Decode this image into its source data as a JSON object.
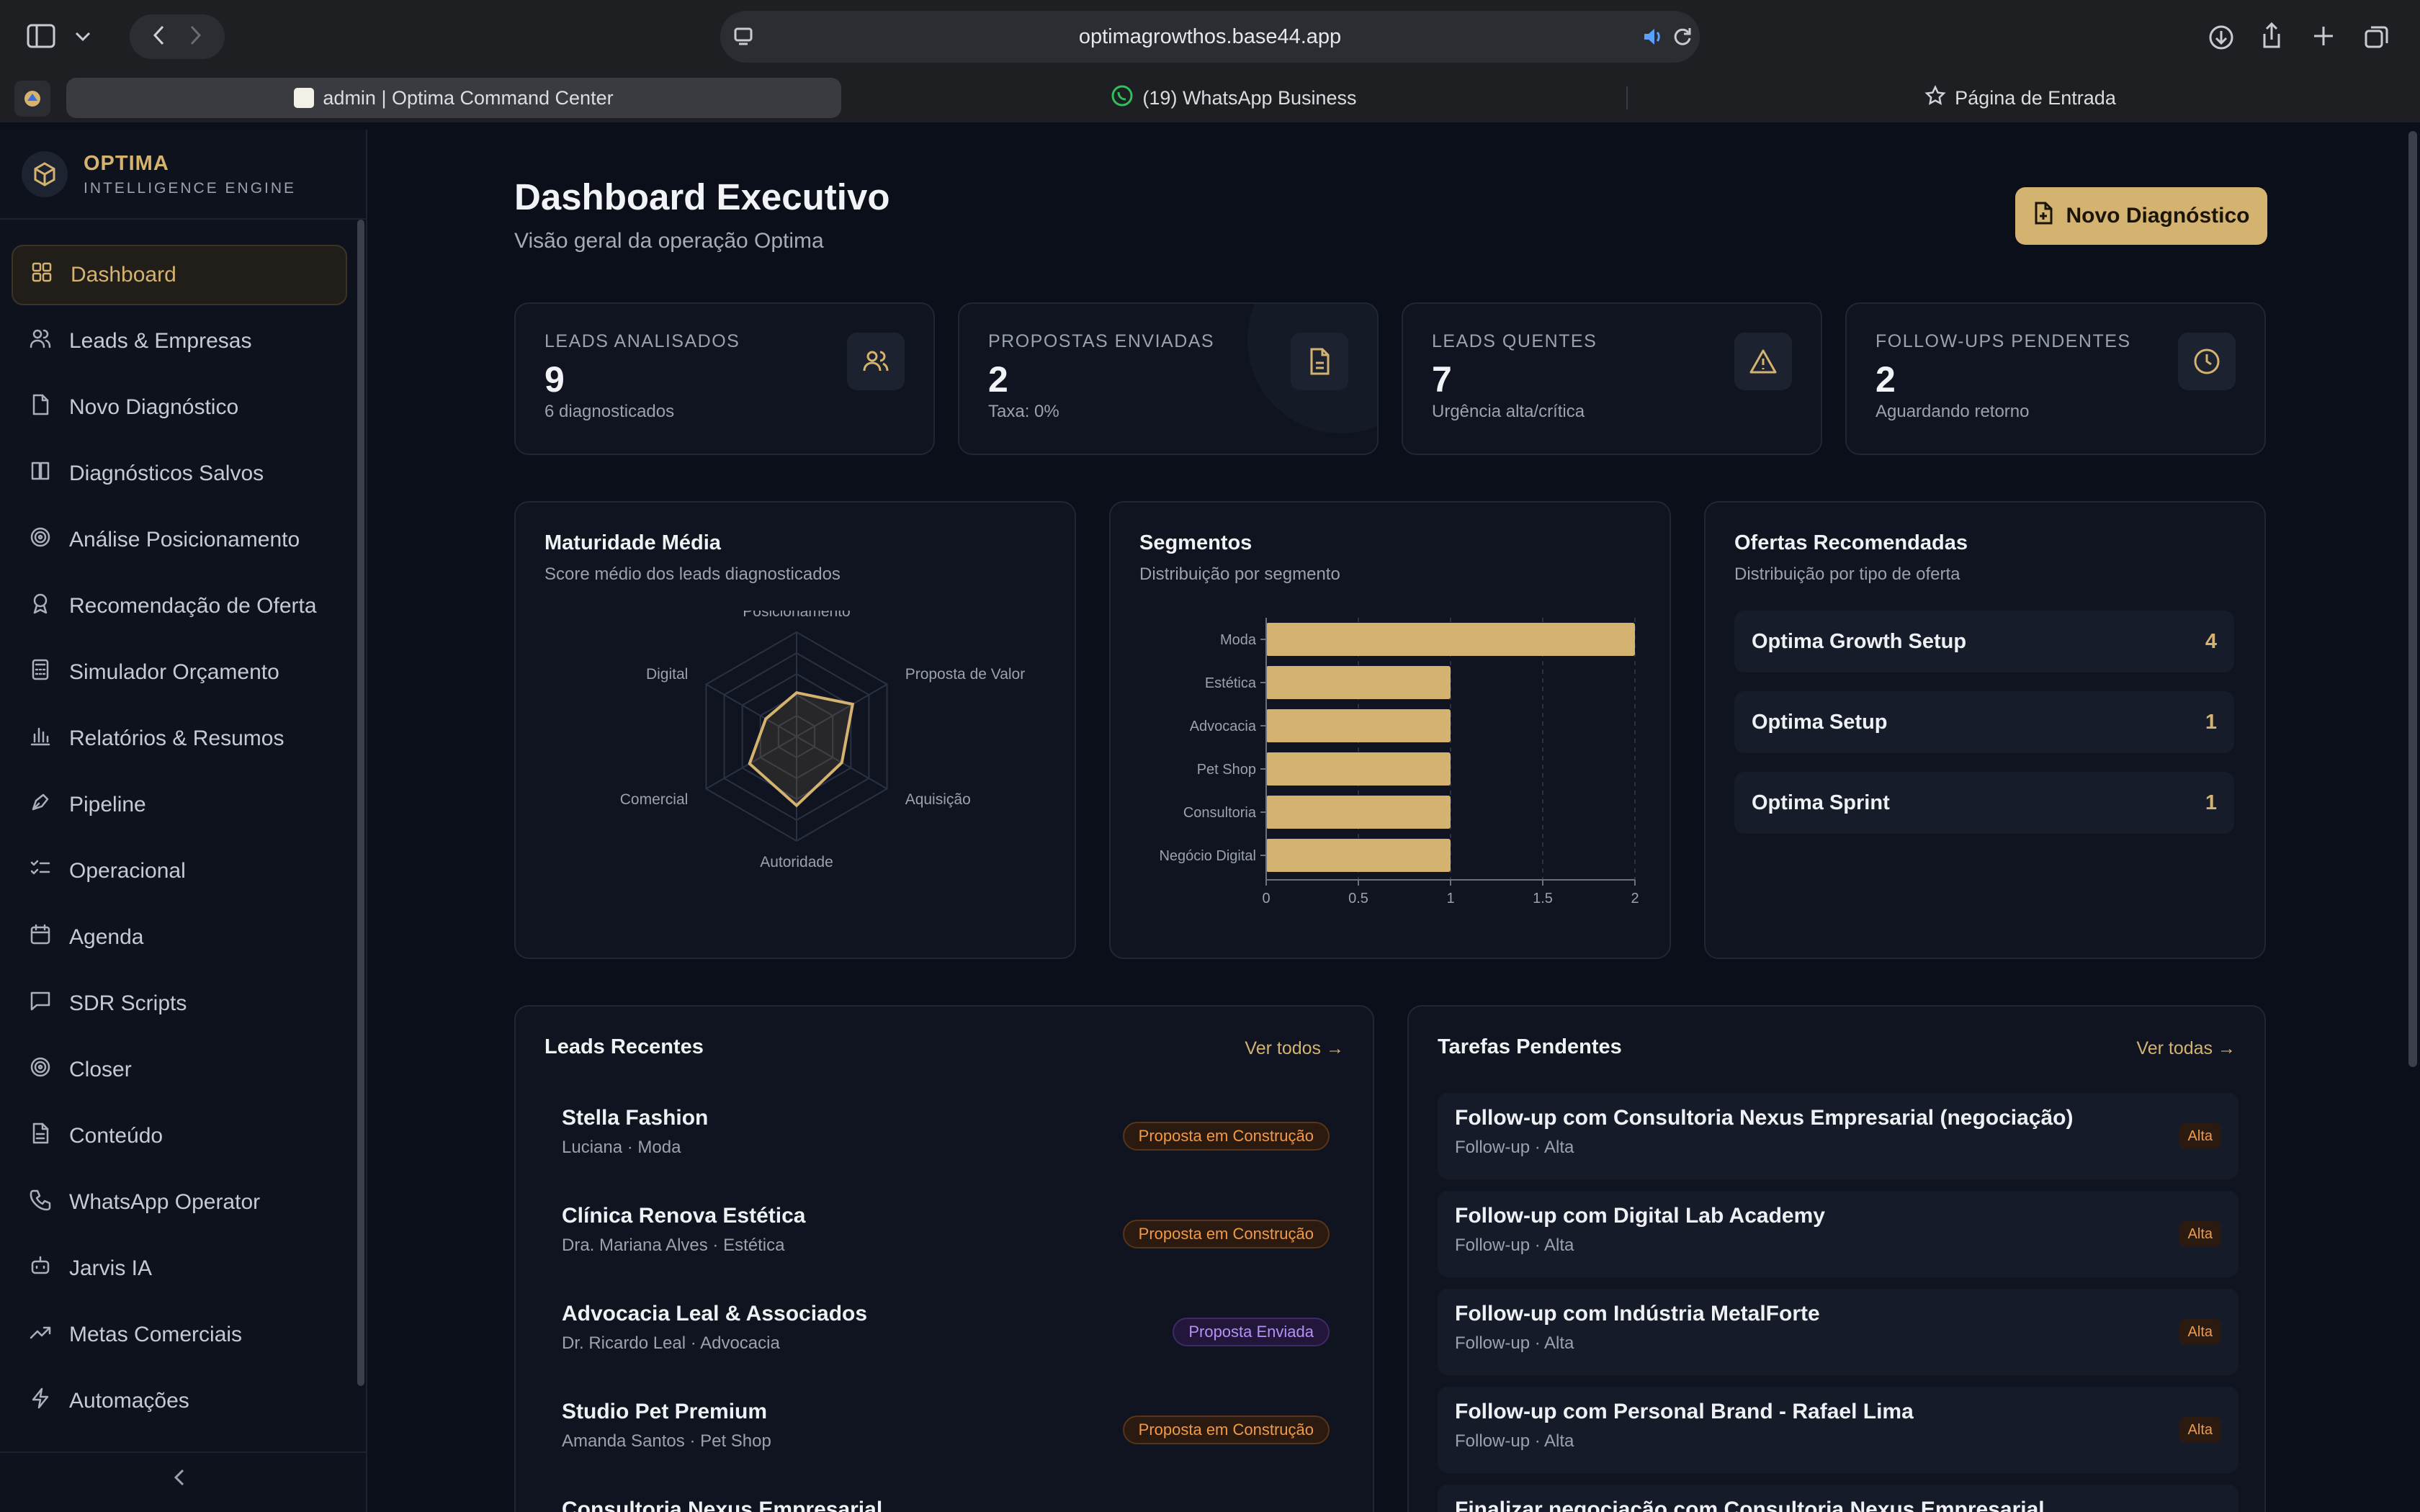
{
  "browser": {
    "url": "optimagrowthos.base44.app",
    "tabs": [
      {
        "label": "admin | Optima Command Center",
        "active": true
      },
      {
        "label": "(19) WhatsApp Business",
        "active": false
      },
      {
        "label": "Página de Entrada",
        "active": false
      }
    ]
  },
  "sidebar": {
    "brand_name": "OPTIMA",
    "brand_sub": "INTELLIGENCE ENGINE",
    "items": [
      {
        "label": "Dashboard",
        "icon": "grid-icon"
      },
      {
        "label": "Leads & Empresas",
        "icon": "users-icon"
      },
      {
        "label": "Novo Diagnóstico",
        "icon": "file-icon"
      },
      {
        "label": "Diagnósticos Salvos",
        "icon": "book-icon"
      },
      {
        "label": "Análise Posicionamento",
        "icon": "target-icon"
      },
      {
        "label": "Recomendação de Oferta",
        "icon": "award-icon"
      },
      {
        "label": "Simulador Orçamento",
        "icon": "calculator-icon"
      },
      {
        "label": "Relatórios & Resumos",
        "icon": "bar-chart-icon"
      },
      {
        "label": "Pipeline",
        "icon": "pen-tool-icon"
      },
      {
        "label": "Operacional",
        "icon": "list-checks-icon"
      },
      {
        "label": "Agenda",
        "icon": "calendar-icon"
      },
      {
        "label": "SDR Scripts",
        "icon": "message-square-icon"
      },
      {
        "label": "Closer",
        "icon": "target-icon"
      },
      {
        "label": "Conteúdo",
        "icon": "file-text-icon"
      },
      {
        "label": "WhatsApp Operator",
        "icon": "phone-icon"
      },
      {
        "label": "Jarvis IA",
        "icon": "bot-icon"
      },
      {
        "label": "Metas Comerciais",
        "icon": "trending-up-icon"
      },
      {
        "label": "Automações",
        "icon": "zap-icon"
      }
    ]
  },
  "header": {
    "title": "Dashboard Executivo",
    "subtitle": "Visão geral da operação Optima",
    "cta_label": "Novo Diagnóstico"
  },
  "stats": [
    {
      "label": "LEADS ANALISADOS",
      "value": "9",
      "sub": "6 diagnosticados",
      "icon": "users-icon"
    },
    {
      "label": "PROPOSTAS ENVIADAS",
      "value": "2",
      "sub": "Taxa: 0%",
      "icon": "file-icon"
    },
    {
      "label": "LEADS QUENTES",
      "value": "7",
      "sub": "Urgência alta/crítica",
      "icon": "alert-triangle-icon"
    },
    {
      "label": "FOLLOW-UPS PENDENTES",
      "value": "2",
      "sub": "Aguardando retorno",
      "icon": "clock-icon"
    }
  ],
  "maturity": {
    "title": "Maturidade Média",
    "subtitle": "Score médio dos leads diagnosticados"
  },
  "segments": {
    "title": "Segmentos",
    "subtitle": "Distribuição por segmento"
  },
  "offers": {
    "title": "Ofertas Recomendadas",
    "subtitle": "Distribuição por tipo de oferta",
    "items": [
      {
        "name": "Optima Growth Setup",
        "count": "4"
      },
      {
        "name": "Optima Setup",
        "count": "1"
      },
      {
        "name": "Optima Sprint",
        "count": "1"
      }
    ]
  },
  "recent_leads": {
    "title": "Leads Recentes",
    "see_all": "Ver todos →",
    "items": [
      {
        "name": "Stella Fashion",
        "meta": "Luciana · Moda",
        "status": "Proposta em Construção",
        "tone": "orange"
      },
      {
        "name": "Clínica Renova Estética",
        "meta": "Dra. Mariana Alves · Estética",
        "status": "Proposta em Construção",
        "tone": "orange"
      },
      {
        "name": "Advocacia Leal & Associados",
        "meta": "Dr. Ricardo Leal · Advocacia",
        "status": "Proposta Enviada",
        "tone": "purple"
      },
      {
        "name": "Studio Pet Premium",
        "meta": "Amanda Santos · Pet Shop",
        "status": "Proposta em Construção",
        "tone": "orange"
      },
      {
        "name": "Consultoria Nexus Empresarial",
        "meta": "",
        "status": "",
        "tone": "orange"
      }
    ]
  },
  "tasks": {
    "title": "Tarefas Pendentes",
    "see_all": "Ver todas →",
    "items": [
      {
        "title": "Follow-up com Consultoria Nexus Empresarial (negociação)",
        "meta": "Follow-up · Alta",
        "priority": "Alta"
      },
      {
        "title": "Follow-up com Digital Lab Academy",
        "meta": "Follow-up · Alta",
        "priority": "Alta"
      },
      {
        "title": "Follow-up com Indústria MetalForte",
        "meta": "Follow-up · Alta",
        "priority": "Alta"
      },
      {
        "title": "Follow-up com Personal Brand - Rafael Lima",
        "meta": "Follow-up · Alta",
        "priority": "Alta"
      },
      {
        "title": "Finalizar negociação com Consultoria Nexus Empresarial",
        "meta": "",
        "priority": ""
      }
    ]
  },
  "chart_data": [
    {
      "type": "radar",
      "axes": [
        "Posicionamento",
        "Proposta de Valor",
        "Aquisição",
        "Autoridade",
        "Comercial",
        "Digital"
      ],
      "values": [
        2.1,
        3.1,
        2.5,
        3.3,
        2.6,
        1.7
      ],
      "range": [
        0,
        5
      ],
      "color": "#d4b26f"
    },
    {
      "type": "bar",
      "orientation": "horizontal",
      "categories": [
        "Moda",
        "Estética",
        "Advocacia",
        "Pet Shop",
        "Consultoria",
        "Negócio Digital"
      ],
      "values": [
        2,
        1,
        1,
        1,
        1,
        1
      ],
      "xlim": [
        0,
        2
      ],
      "xticks": [
        "0",
        "0.5",
        "1",
        "1.5",
        "2"
      ],
      "color": "#d4b26f"
    }
  ],
  "colors": {
    "accent": "#d4b26f",
    "background": "#0b0f19",
    "card": "#0f1420"
  }
}
